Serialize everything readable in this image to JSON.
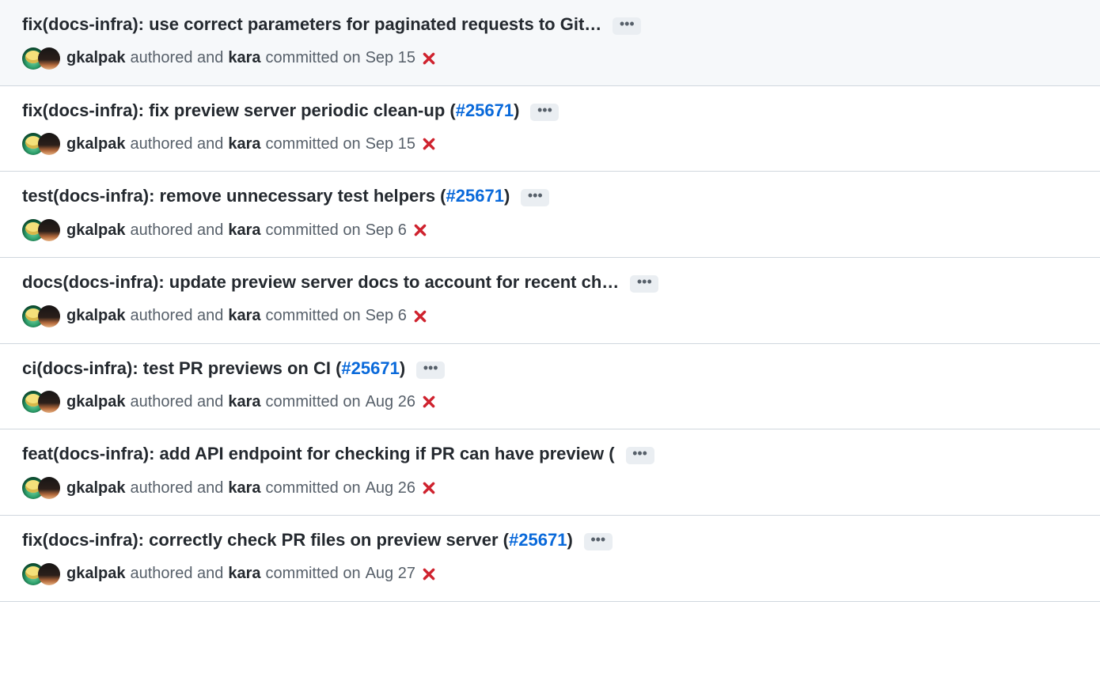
{
  "issue_label": "#25671",
  "commits": [
    {
      "title_pre": "fix(docs-infra): use correct parameters for paginated requests to Git…",
      "has_issue": false,
      "title_post": "",
      "highlighted": true,
      "author": "gkalpak",
      "mid1": "authored and",
      "committer": "kara",
      "mid2": "committed on",
      "date": "Sep 15"
    },
    {
      "title_pre": "fix(docs-infra): fix preview server periodic clean-up (",
      "has_issue": true,
      "title_post": ")",
      "highlighted": false,
      "author": "gkalpak",
      "mid1": "authored and",
      "committer": "kara",
      "mid2": "committed on",
      "date": "Sep 15"
    },
    {
      "title_pre": "test(docs-infra): remove unnecessary test helpers (",
      "has_issue": true,
      "title_post": ")",
      "highlighted": false,
      "author": "gkalpak",
      "mid1": "authored and",
      "committer": "kara",
      "mid2": "committed on",
      "date": "Sep 6"
    },
    {
      "title_pre": "docs(docs-infra): update preview server docs to account for recent ch…",
      "has_issue": false,
      "title_post": "",
      "highlighted": false,
      "author": "gkalpak",
      "mid1": "authored and",
      "committer": "kara",
      "mid2": "committed on",
      "date": "Sep 6"
    },
    {
      "title_pre": "ci(docs-infra): test PR previews on CI (",
      "has_issue": true,
      "title_post": ")",
      "highlighted": false,
      "author": "gkalpak",
      "mid1": "authored and",
      "committer": "kara",
      "mid2": "committed on",
      "date": "Aug 26"
    },
    {
      "title_pre": "feat(docs-infra): add API endpoint for checking if PR can have preview (",
      "has_issue": false,
      "title_post": "",
      "highlighted": false,
      "author": "gkalpak",
      "mid1": "authored and",
      "committer": "kara",
      "mid2": "committed on",
      "date": "Aug 26"
    },
    {
      "title_pre": "fix(docs-infra): correctly check PR files on preview server (",
      "has_issue": true,
      "title_post": ")",
      "highlighted": false,
      "author": "gkalpak",
      "mid1": "authored and",
      "committer": "kara",
      "mid2": "committed on",
      "date": "Aug 27"
    }
  ]
}
